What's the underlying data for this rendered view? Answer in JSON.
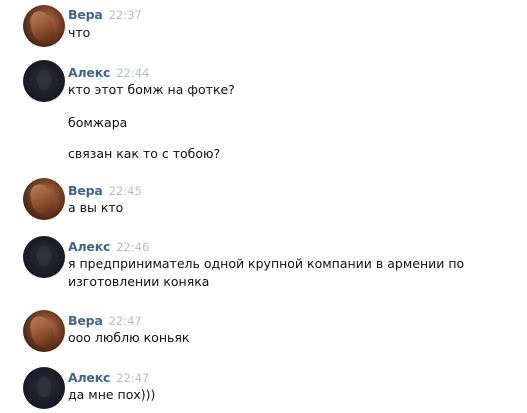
{
  "messages": [
    {
      "author": "Вера",
      "time": "22:37",
      "avatar": "vera-avatar",
      "lines": [
        "что"
      ]
    },
    {
      "author": "Алекс",
      "time": "22:44",
      "avatar": "alex-avatar",
      "lines": [
        "кто этот бомж на фотке?",
        "бомжара",
        "связан как то с тобою?"
      ]
    },
    {
      "author": "Вера",
      "time": "22:45",
      "avatar": "vera-avatar",
      "lines": [
        "а вы кто"
      ]
    },
    {
      "author": "Алекс",
      "time": "22:46",
      "avatar": "alex-avatar",
      "lines": [
        "я предприниматель одной крупной компании в армении по",
        "изготовлении коняка"
      ]
    },
    {
      "author": "Вера",
      "time": "22:47",
      "avatar": "vera-avatar",
      "lines": [
        "ооо люблю коньяк"
      ]
    },
    {
      "author": "Алекс",
      "time": "22:47",
      "avatar": "alex-avatar",
      "lines": [
        "да мне пох)))"
      ]
    }
  ],
  "colors": {
    "author_name": "#42648b",
    "timestamp": "#b5bcc4",
    "message_text": "#111111",
    "background": "#ffffff"
  }
}
